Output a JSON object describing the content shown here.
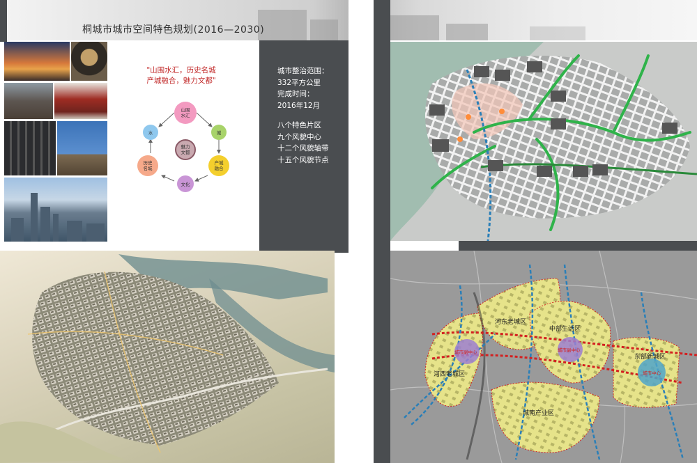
{
  "title": "桐城市城市空间特色规划(2016—2030)",
  "slogan": {
    "line1": "\"山围水汇，历史名城",
    "line2": "产城融合，魅力文都\""
  },
  "cycle": {
    "top": "山围水汇",
    "center": "魅力文都",
    "left": "水",
    "right": "城",
    "bottom_left": "历史名城",
    "bottom_right": "产城融合",
    "bottom": "文化"
  },
  "info": {
    "scope_label": "城市整治范围：",
    "scope_value": "332平方公里",
    "time_label": "完成时间：",
    "time_value": "2016年12月",
    "item1": "八个特色片区",
    "item2": "九个风貌中心",
    "item3": "十二个风貌轴带",
    "item4": "十五个风貌节点"
  },
  "map2_labels": {
    "hedong": "河东老城区",
    "zhongbu": "中部生活区",
    "dongbu": "东部新城区",
    "hexi": "河西老城区",
    "chengnan": "城南产业区",
    "center1": "城市副中心",
    "center2": "城市副中心",
    "center3": "城市中心"
  },
  "colors": {
    "panel_dark": "#4a4d50",
    "slogan_red": "#c22a2a",
    "axis_green": "#2fb34a",
    "axis_blue": "#2a7fb8",
    "zone_yellow": "#e6e38a",
    "axis_red": "#d32020"
  }
}
